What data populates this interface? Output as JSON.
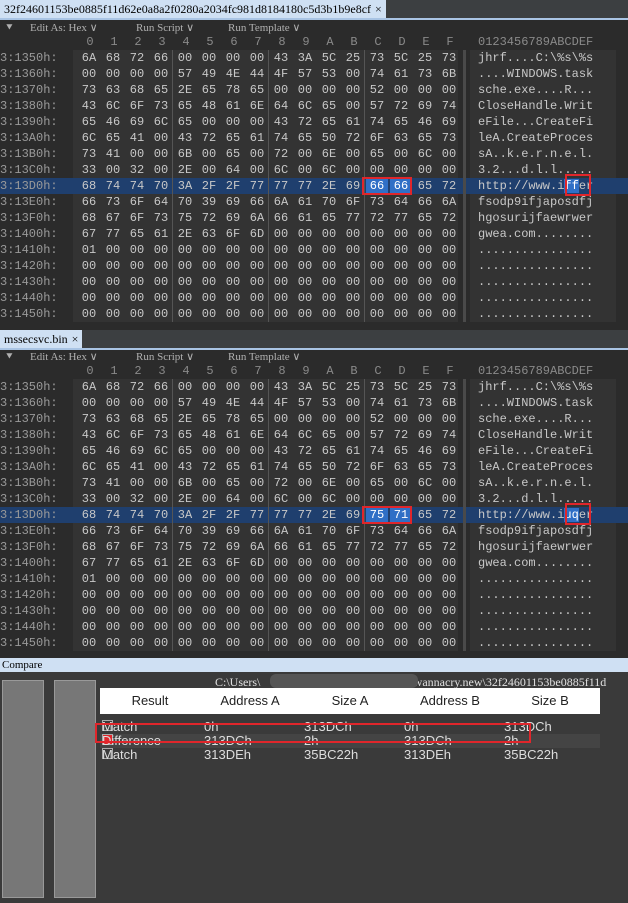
{
  "tab_a": {
    "title": "32f24601153be0885f11d62e0a8a2f0280a2034fc981d8184180c5d3b1b9e8cf",
    "close": "×"
  },
  "tab_b": {
    "title": "mssecsvc.bin",
    "close": "×"
  },
  "toolbar": {
    "collapse": "⯆",
    "edit_as": "Edit As: Hex ∨",
    "run_script": "Run Script ∨",
    "run_template": "Run Template ∨"
  },
  "column_headers": [
    "0",
    "1",
    "2",
    "3",
    "4",
    "5",
    "6",
    "7",
    "8",
    "9",
    "A",
    "B",
    "C",
    "D",
    "E",
    "F"
  ],
  "ascii_header": "0123456789ABCDEF",
  "pane_a": {
    "highlight_row": "3:13D0h",
    "selected_bytes": [
      12,
      13
    ],
    "selected_ascii": [
      12,
      13
    ],
    "rows": [
      {
        "addr": "3:1350h:",
        "hex": "6A 68 72 66 00 00 00 00 43 3A 5C 25 73 5C 25 73",
        "ascii": "jhrf....C:\\%s\\%s"
      },
      {
        "addr": "3:1360h:",
        "hex": "00 00 00 00 57 49 4E 44 4F 57 53 00 74 61 73 6B",
        "ascii": "....WINDOWS.task"
      },
      {
        "addr": "3:1370h:",
        "hex": "73 63 68 65 2E 65 78 65 00 00 00 00 52 00 00 00",
        "ascii": "sche.exe....R..."
      },
      {
        "addr": "3:1380h:",
        "hex": "43 6C 6F 73 65 48 61 6E 64 6C 65 00 57 72 69 74",
        "ascii": "CloseHandle.Writ"
      },
      {
        "addr": "3:1390h:",
        "hex": "65 46 69 6C 65 00 00 00 43 72 65 61 74 65 46 69",
        "ascii": "eFile...CreateFi"
      },
      {
        "addr": "3:13A0h:",
        "hex": "6C 65 41 00 43 72 65 61 74 65 50 72 6F 63 65 73",
        "ascii": "leA.CreateProces"
      },
      {
        "addr": "3:13B0h:",
        "hex": "73 41 00 00 6B 00 65 00 72 00 6E 00 65 00 6C 00",
        "ascii": "sA..k.e.r.n.e.l."
      },
      {
        "addr": "3:13C0h:",
        "hex": "33 00 32 00 2E 00 64 00 6C 00 6C 00 00 00 00 00",
        "ascii": "3.2...d.l.l....."
      },
      {
        "addr": "3:13D0h:",
        "hex": "68 74 74 70 3A 2F 2F 77 77 77 2E 69 66 66 65 72",
        "ascii": "http://www.iffer"
      },
      {
        "addr": "3:13E0h:",
        "hex": "66 73 6F 64 70 39 69 66 6A 61 70 6F 73 64 66 6A",
        "ascii": "fsodp9ifjaposdfj"
      },
      {
        "addr": "3:13F0h:",
        "hex": "68 67 6F 73 75 72 69 6A 66 61 65 77 72 77 65 72",
        "ascii": "hgosurijfaewrwer"
      },
      {
        "addr": "3:1400h:",
        "hex": "67 77 65 61 2E 63 6F 6D 00 00 00 00 00 00 00 00",
        "ascii": "gwea.com........"
      },
      {
        "addr": "3:1410h:",
        "hex": "01 00 00 00 00 00 00 00 00 00 00 00 00 00 00 00",
        "ascii": "................"
      },
      {
        "addr": "3:1420h:",
        "hex": "00 00 00 00 00 00 00 00 00 00 00 00 00 00 00 00",
        "ascii": "................"
      },
      {
        "addr": "3:1430h:",
        "hex": "00 00 00 00 00 00 00 00 00 00 00 00 00 00 00 00",
        "ascii": "................"
      },
      {
        "addr": "3:1440h:",
        "hex": "00 00 00 00 00 00 00 00 00 00 00 00 00 00 00 00",
        "ascii": "................"
      },
      {
        "addr": "3:1450h:",
        "hex": "00 00 00 00 00 00 00 00 00 00 00 00 00 00 00 00",
        "ascii": "................"
      }
    ]
  },
  "pane_b": {
    "highlight_row": "3:13D0h",
    "selected_bytes": [
      12,
      13
    ],
    "selected_ascii": [
      12,
      13
    ],
    "rows": [
      {
        "addr": "3:1350h:",
        "hex": "6A 68 72 66 00 00 00 00 43 3A 5C 25 73 5C 25 73",
        "ascii": "jhrf....C:\\%s\\%s"
      },
      {
        "addr": "3:1360h:",
        "hex": "00 00 00 00 57 49 4E 44 4F 57 53 00 74 61 73 6B",
        "ascii": "....WINDOWS.task"
      },
      {
        "addr": "3:1370h:",
        "hex": "73 63 68 65 2E 65 78 65 00 00 00 00 52 00 00 00",
        "ascii": "sche.exe....R..."
      },
      {
        "addr": "3:1380h:",
        "hex": "43 6C 6F 73 65 48 61 6E 64 6C 65 00 57 72 69 74",
        "ascii": "CloseHandle.Writ"
      },
      {
        "addr": "3:1390h:",
        "hex": "65 46 69 6C 65 00 00 00 43 72 65 61 74 65 46 69",
        "ascii": "eFile...CreateFi"
      },
      {
        "addr": "3:13A0h:",
        "hex": "6C 65 41 00 43 72 65 61 74 65 50 72 6F 63 65 73",
        "ascii": "leA.CreateProces"
      },
      {
        "addr": "3:13B0h:",
        "hex": "73 41 00 00 6B 00 65 00 72 00 6E 00 65 00 6C 00",
        "ascii": "sA..k.e.r.n.e.l."
      },
      {
        "addr": "3:13C0h:",
        "hex": "33 00 32 00 2E 00 64 00 6C 00 6C 00 00 00 00 00",
        "ascii": "3.2...d.l.l....."
      },
      {
        "addr": "3:13D0h:",
        "hex": "68 74 74 70 3A 2F 2F 77 77 77 2E 69 75 71 65 72",
        "ascii": "http://www.iuqer"
      },
      {
        "addr": "3:13E0h:",
        "hex": "66 73 6F 64 70 39 69 66 6A 61 70 6F 73 64 66 6A",
        "ascii": "fsodp9ifjaposdfj"
      },
      {
        "addr": "3:13F0h:",
        "hex": "68 67 6F 73 75 72 69 6A 66 61 65 77 72 77 65 72",
        "ascii": "hgosurijfaewrwer"
      },
      {
        "addr": "3:1400h:",
        "hex": "67 77 65 61 2E 63 6F 6D 00 00 00 00 00 00 00 00",
        "ascii": "gwea.com........"
      },
      {
        "addr": "3:1410h:",
        "hex": "01 00 00 00 00 00 00 00 00 00 00 00 00 00 00 00",
        "ascii": "................"
      },
      {
        "addr": "3:1420h:",
        "hex": "00 00 00 00 00 00 00 00 00 00 00 00 00 00 00 00",
        "ascii": "................"
      },
      {
        "addr": "3:1430h:",
        "hex": "00 00 00 00 00 00 00 00 00 00 00 00 00 00 00 00",
        "ascii": "................"
      },
      {
        "addr": "3:1440h:",
        "hex": "00 00 00 00 00 00 00 00 00 00 00 00 00 00 00 00",
        "ascii": "................"
      },
      {
        "addr": "3:1450h:",
        "hex": "00 00 00 00 00 00 00 00 00 00 00 00 00 00 00 00",
        "ascii": "................"
      }
    ]
  },
  "compare": {
    "title": "Compare",
    "path_prefix": "C:\\Users\\",
    "path_suffix": "\\wannacry.new\\32f24601153be0885f11d",
    "columns": [
      "Result",
      "Address A",
      "Size A",
      "Address B",
      "Size B"
    ],
    "rows": [
      {
        "result": "Match",
        "addr_a": "0h",
        "size_a": "313DCh",
        "addr_b": "0h",
        "size_b": "313DCh",
        "color": "#3a3a3a"
      },
      {
        "result": "Difference",
        "addr_a": "313DCh",
        "size_a": "2h",
        "addr_b": "313DCh",
        "size_b": "2h",
        "color": "#e0262b"
      },
      {
        "result": "Match",
        "addr_a": "313DEh",
        "size_a": "35BC22h",
        "addr_b": "313DEh",
        "size_b": "35BC22h",
        "color": "#3a3a3a"
      }
    ]
  }
}
